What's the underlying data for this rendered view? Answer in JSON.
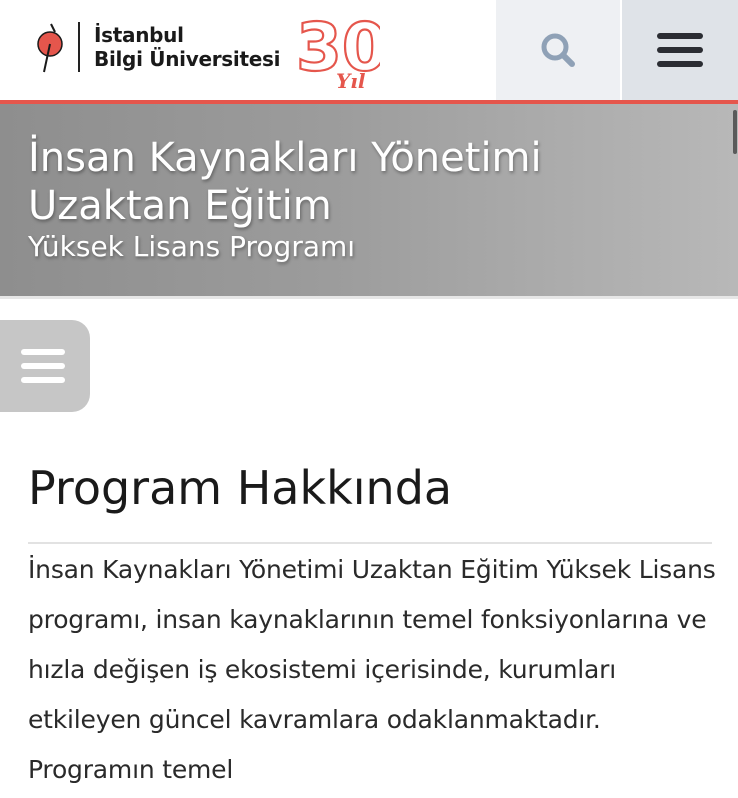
{
  "header": {
    "logo_line1": "İstanbul",
    "logo_line2": "Bilgi Üniversitesi",
    "anniversary_number": "30",
    "anniversary_word": "Yıl",
    "search_icon": "search-icon",
    "menu_icon": "hamburger-menu-icon",
    "accent_color": "#e5564c"
  },
  "hero": {
    "title": "İnsan Kaynakları Yönetimi Uzaktan Eğitim",
    "subtitle": "Yüksek Lisans Programı"
  },
  "side_menu": {
    "icon": "hamburger-menu-icon"
  },
  "content": {
    "section_title": "Program Hakkında",
    "paragraph": "İnsan Kaynakları Yönetimi Uzaktan Eğitim Yüksek Lisans programı, insan kaynaklarının temel fonksiyonlarına ve hızla değişen iş ekosistemi içerisinde, kurumları etkileyen güncel kavramlara odaklanmaktadır. Programın temel"
  }
}
